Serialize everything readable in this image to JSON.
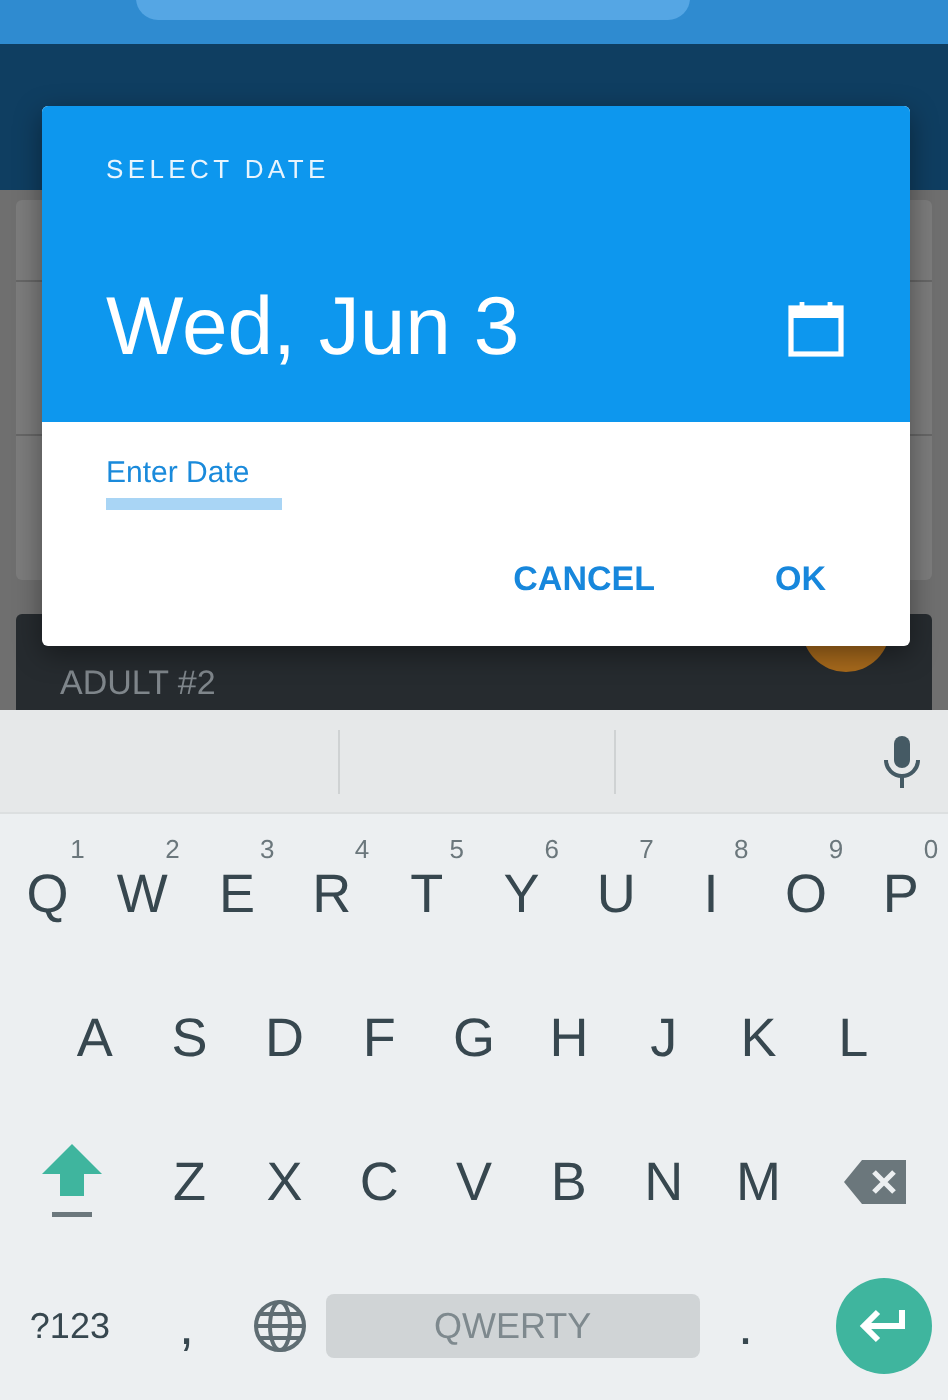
{
  "background": {
    "section_title": "ADULT #2"
  },
  "dialog": {
    "title": "SELECT DATE",
    "date": "Wed, Jun 3",
    "field": {
      "label": "Enter Date"
    },
    "buttons": [
      "CANCEL",
      "OK"
    ]
  },
  "keyboard": {
    "rows": [
      [
        {
          "kind": "letter",
          "label": "Q",
          "hint": "1"
        },
        {
          "kind": "letter",
          "label": "W",
          "hint": "2"
        },
        {
          "kind": "letter",
          "label": "E",
          "hint": "3"
        },
        {
          "kind": "letter",
          "label": "R",
          "hint": "4"
        },
        {
          "kind": "letter",
          "label": "T",
          "hint": "5"
        },
        {
          "kind": "letter",
          "label": "Y",
          "hint": "6"
        },
        {
          "kind": "letter",
          "label": "U",
          "hint": "7"
        },
        {
          "kind": "letter",
          "label": "I",
          "hint": "8"
        },
        {
          "kind": "letter",
          "label": "O",
          "hint": "9"
        },
        {
          "kind": "letter",
          "label": "P",
          "hint": "0"
        }
      ],
      [
        {
          "kind": "letter",
          "label": "A"
        },
        {
          "kind": "letter",
          "label": "S"
        },
        {
          "kind": "letter",
          "label": "D"
        },
        {
          "kind": "letter",
          "label": "F"
        },
        {
          "kind": "letter",
          "label": "G"
        },
        {
          "kind": "letter",
          "label": "H"
        },
        {
          "kind": "letter",
          "label": "J"
        },
        {
          "kind": "letter",
          "label": "K"
        },
        {
          "kind": "letter",
          "label": "L"
        }
      ],
      [
        {
          "kind": "shift"
        },
        {
          "kind": "letter",
          "label": "Z"
        },
        {
          "kind": "letter",
          "label": "X"
        },
        {
          "kind": "letter",
          "label": "C"
        },
        {
          "kind": "letter",
          "label": "V"
        },
        {
          "kind": "letter",
          "label": "B"
        },
        {
          "kind": "letter",
          "label": "N"
        },
        {
          "kind": "letter",
          "label": "M"
        },
        {
          "kind": "backspace"
        }
      ]
    ],
    "bottom_row": {
      "symbols_key": "?123",
      "comma_key": ",",
      "space_bar": "QWERTY",
      "period_key": "."
    }
  }
}
